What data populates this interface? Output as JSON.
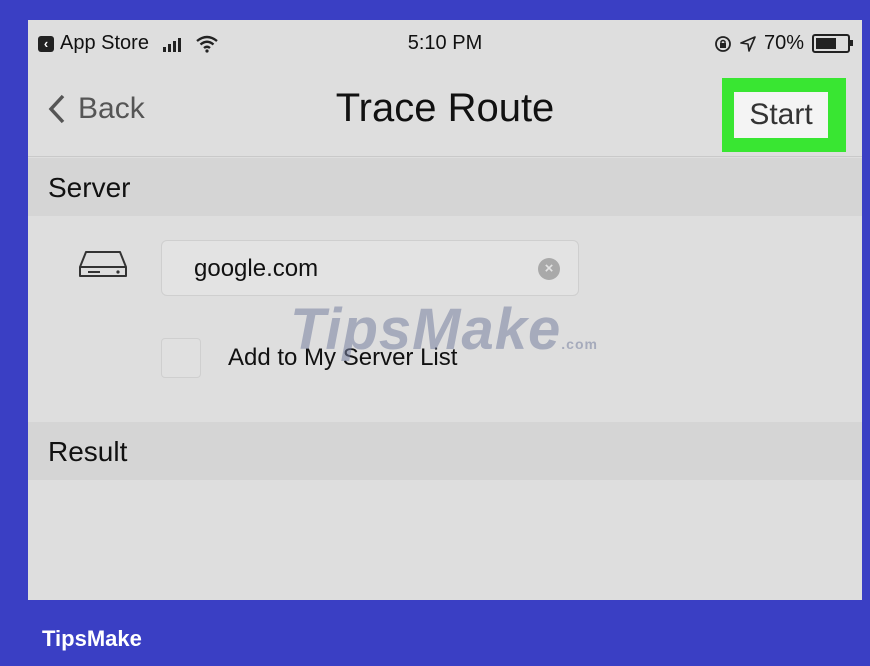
{
  "statusbar": {
    "carrier_back": "App Store",
    "time": "5:10 PM",
    "battery": "70%",
    "battery_level": 0.7,
    "icons": [
      "back-app-icon",
      "signal-icon",
      "wifi-icon",
      "rotation-lock-icon",
      "location-icon",
      "battery-icon"
    ]
  },
  "navbar": {
    "back_label": "Back",
    "title": "Trace Route",
    "start_label": "Start",
    "highlight_color": "#39e632"
  },
  "server": {
    "header": "Server",
    "host_value": "google.com",
    "add_to_list_label": "Add to My Server List"
  },
  "result": {
    "header": "Result"
  },
  "watermark": {
    "text": "TipsMake",
    "suffix": ".com"
  },
  "brand": "TipsMake",
  "colors": {
    "frame": "#3a3fc4",
    "background": "#dedede",
    "section_header": "#d5d5d5"
  }
}
